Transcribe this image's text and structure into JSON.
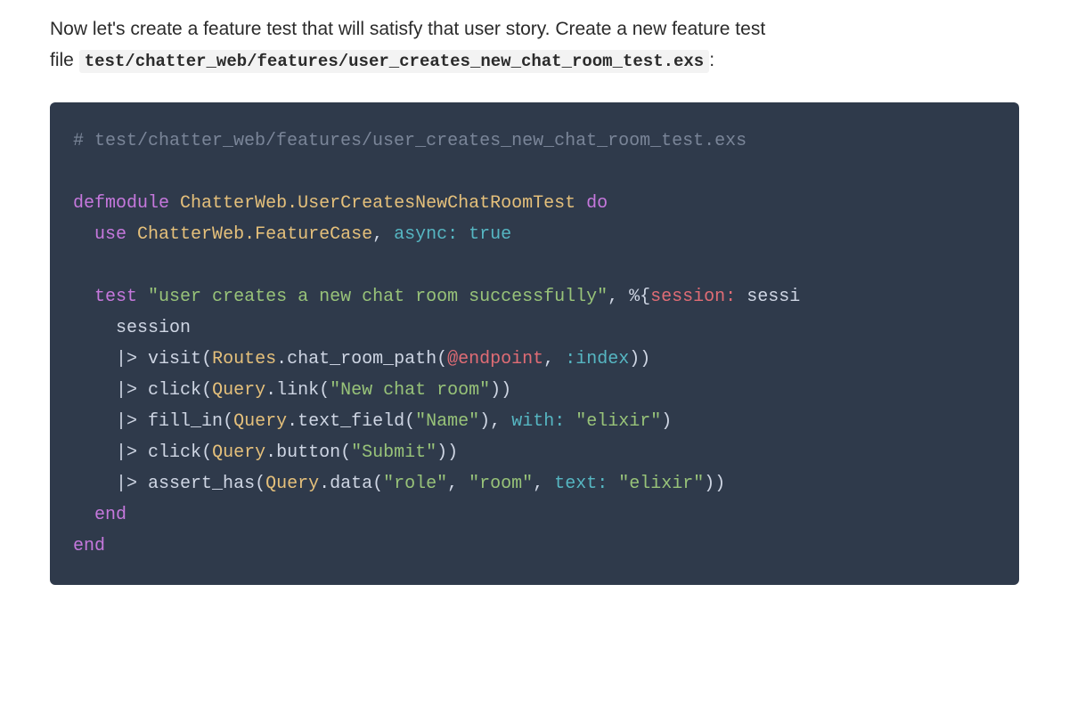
{
  "prose": {
    "line1": "Now let's create a feature test that will satisfy that user story. Create a new feature test",
    "line2_prefix": "file ",
    "inline_code": "test/chatter_web/features/user_creates_new_chat_room_test.exs",
    "line2_suffix": ":"
  },
  "code": {
    "comment": "# test/chatter_web/features/user_creates_new_chat_room_test.exs",
    "blank": "",
    "kw_defmodule": "defmodule",
    "module_name": "ChatterWeb.UserCreatesNewChatRoomTest",
    "kw_do": "do",
    "kw_use": "use",
    "feature_case": "ChatterWeb.FeatureCase",
    "comma_sp": ", ",
    "async_key": "async:",
    "true_val": "true",
    "kw_test": "test",
    "test_name": "\"user creates a new chat room successfully\"",
    "map_open": "%{",
    "session_key": "session:",
    "session_var": "sessi",
    "session_line": "session",
    "pipe": "|>",
    "visit": "visit",
    "routes": "Routes",
    "chat_room_path": ".chat_room_path",
    "at_endpoint": "@endpoint",
    "index_atom": ":index",
    "click": "click",
    "query": "Query",
    "link": ".link",
    "new_chat_room": "\"New chat room\"",
    "fill_in": "fill_in",
    "text_field": ".text_field",
    "name_str": "\"Name\"",
    "with_key": "with:",
    "elixir_str": "\"elixir\"",
    "button": ".button",
    "submit_str": "\"Submit\"",
    "assert_has": "assert_has",
    "data_fn": ".data",
    "role_str": "\"role\"",
    "room_str": "\"room\"",
    "text_key": "text:",
    "kw_end": "end",
    "open_paren": "(",
    "close_paren": ")",
    "close_paren2": "))",
    "space": " ",
    "indent1": "  ",
    "indent2": "    ",
    "indent3": "    "
  }
}
